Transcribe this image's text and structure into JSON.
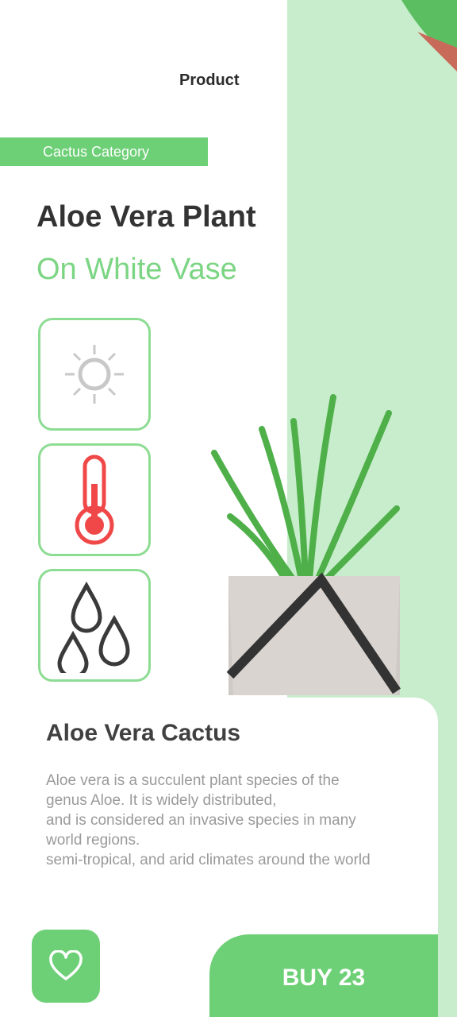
{
  "header": {
    "title": "Product"
  },
  "category": {
    "label": "Cactus Category"
  },
  "product": {
    "name": "Aloe Vera Plant",
    "subtitle": "On White Vase"
  },
  "features": [
    {
      "icon": "sun-icon"
    },
    {
      "icon": "thermometer-icon"
    },
    {
      "icon": "water-drops-icon"
    }
  ],
  "description": {
    "title": "Aloe Vera Cactus",
    "lines": [
      "Aloe vera is a succulent plant species of the",
      "genus Aloe. It is widely distributed,",
      "and is considered an invasive species in many",
      "world regions.",
      "semi-tropical, and arid climates around the world"
    ]
  },
  "actions": {
    "buy_label": "BUY 23",
    "favorite_icon": "heart-icon"
  },
  "colors": {
    "accent": "#6dcf76",
    "panel": "#c8edcc",
    "subtitle": "#7cd583",
    "thermometer": "#f04848"
  }
}
